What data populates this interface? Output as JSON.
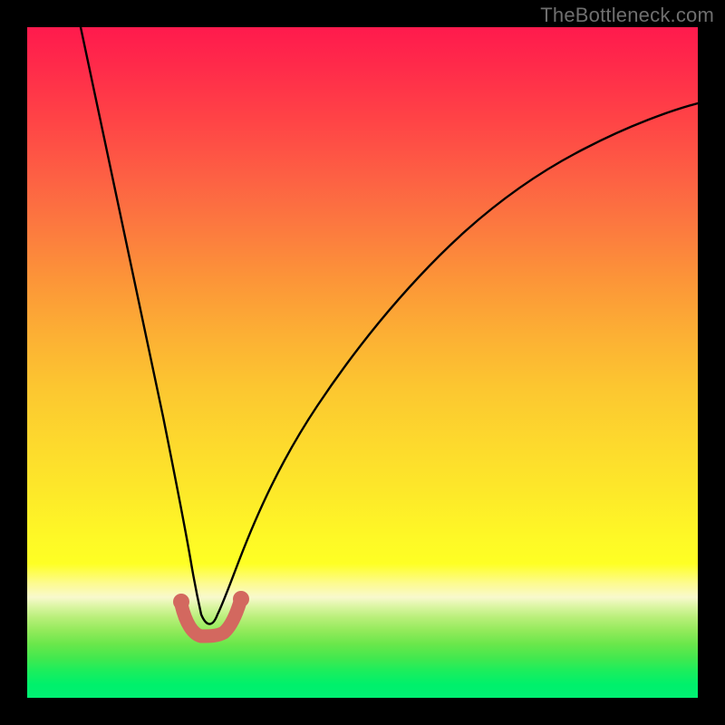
{
  "watermark": {
    "text": "TheBottleneck.com"
  },
  "colors": {
    "page_bg": "#000000",
    "curve_stroke": "#000000",
    "valley_stroke": "#d3685f",
    "gradient_stops": [
      "#ff1a4d",
      "#ff2b4a",
      "#ff4446",
      "#fd5f44",
      "#fc7a3f",
      "#fc9638",
      "#fcb034",
      "#fcc730",
      "#fdd92d",
      "#fdea29",
      "#fef826",
      "#feff24",
      "#fdfb92",
      "#f8f9cd",
      "#d8f5a0",
      "#b9ef7a",
      "#92ea5b",
      "#6ae74b",
      "#44e84e",
      "#1bee5d",
      "#00f06b",
      "#00f173"
    ]
  },
  "chart_data": {
    "type": "line",
    "title": "",
    "xlabel": "",
    "ylabel": "",
    "x_range": [
      0,
      100
    ],
    "y_range": [
      0,
      100
    ],
    "note": "No axes or tick labels are shown; values are estimated positions (percent of plot width/height, origin at bottom-left).",
    "series": [
      {
        "name": "main-bottleneck-curve",
        "x": [
          8,
          10,
          12,
          14,
          16,
          18,
          20,
          22,
          23.5,
          25,
          26.5,
          28,
          30,
          32,
          35,
          40,
          45,
          50,
          55,
          60,
          65,
          70,
          75,
          80,
          85,
          90,
          95,
          100
        ],
        "y": [
          100,
          88,
          76,
          65,
          54,
          43,
          32,
          21,
          13,
          10,
          10,
          13,
          19,
          25,
          32,
          42,
          49,
          55,
          60,
          65,
          69,
          72.5,
          75.5,
          78,
          80,
          82,
          83.5,
          85
        ]
      },
      {
        "name": "valley-highlight",
        "x": [
          22,
          23.5,
          25,
          26.5,
          28
        ],
        "y": [
          14,
          10.5,
          10,
          10.5,
          14
        ]
      }
    ],
    "minimum_point": {
      "x": 25,
      "y": 10
    }
  }
}
